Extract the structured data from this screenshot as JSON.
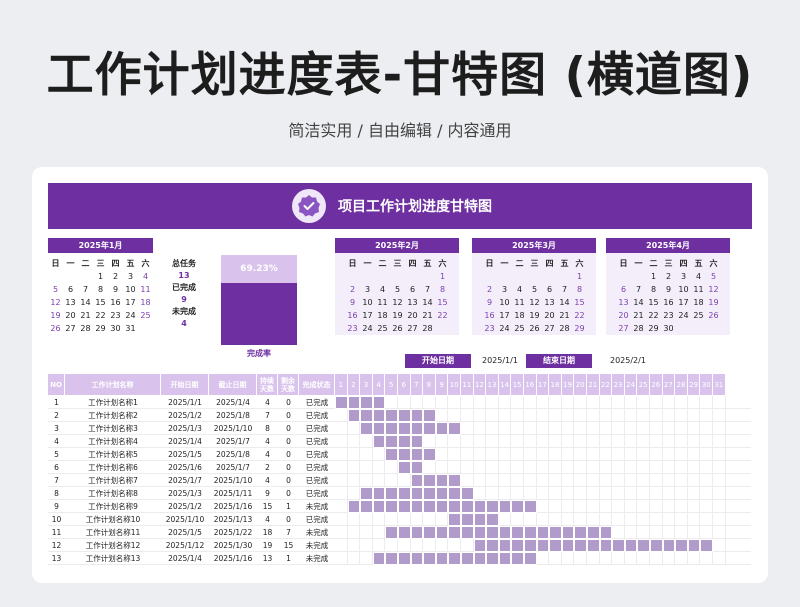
{
  "page": {
    "title": "工作计划进度表-甘特图 (横道图)",
    "subtitle": "简洁实用 / 自由编辑 / 内容通用"
  },
  "banner": {
    "title": "项目工作计划进度甘特图",
    "icon": "check-badge-icon"
  },
  "colors": {
    "accent": "#6e2fa0",
    "light": "#d9c3ed",
    "bar": "#b09bcb",
    "bg": "#eceef1"
  },
  "calendars": [
    {
      "title": "2025年1月",
      "weekdays": [
        "日",
        "一",
        "二",
        "三",
        "四",
        "五",
        "六"
      ],
      "weeks": [
        [
          "",
          "",
          "",
          "1",
          "2",
          "3",
          "4"
        ],
        [
          "5",
          "6",
          "7",
          "8",
          "9",
          "10",
          "11"
        ],
        [
          "12",
          "13",
          "14",
          "15",
          "16",
          "17",
          "18"
        ],
        [
          "19",
          "20",
          "21",
          "22",
          "23",
          "24",
          "25"
        ],
        [
          "26",
          "27",
          "28",
          "29",
          "30",
          "31",
          ""
        ]
      ]
    },
    {
      "title": "2025年2月",
      "weekdays": [
        "日",
        "一",
        "二",
        "三",
        "四",
        "五",
        "六"
      ],
      "weeks": [
        [
          "",
          "",
          "",
          "",
          "",
          "",
          "1"
        ],
        [
          "2",
          "3",
          "4",
          "5",
          "6",
          "7",
          "8"
        ],
        [
          "9",
          "10",
          "11",
          "12",
          "13",
          "14",
          "15"
        ],
        [
          "16",
          "17",
          "18",
          "19",
          "20",
          "21",
          "22"
        ],
        [
          "23",
          "24",
          "25",
          "26",
          "27",
          "28",
          ""
        ]
      ]
    },
    {
      "title": "2025年3月",
      "weekdays": [
        "日",
        "一",
        "二",
        "三",
        "四",
        "五",
        "六"
      ],
      "weeks": [
        [
          "",
          "",
          "",
          "",
          "",
          "",
          "1"
        ],
        [
          "2",
          "3",
          "4",
          "5",
          "6",
          "7",
          "8"
        ],
        [
          "9",
          "10",
          "11",
          "12",
          "13",
          "14",
          "15"
        ],
        [
          "16",
          "17",
          "18",
          "19",
          "20",
          "21",
          "22"
        ],
        [
          "23",
          "24",
          "25",
          "26",
          "27",
          "28",
          "29"
        ]
      ]
    },
    {
      "title": "2025年4月",
      "weekdays": [
        "日",
        "一",
        "二",
        "三",
        "四",
        "五",
        "六"
      ],
      "weeks": [
        [
          "",
          "",
          "1",
          "2",
          "3",
          "4",
          "5"
        ],
        [
          "6",
          "7",
          "8",
          "9",
          "10",
          "11",
          "12"
        ],
        [
          "13",
          "14",
          "15",
          "16",
          "17",
          "18",
          "19"
        ],
        [
          "20",
          "21",
          "22",
          "23",
          "24",
          "25",
          "26"
        ],
        [
          "27",
          "28",
          "29",
          "30",
          "",
          "",
          ""
        ]
      ]
    }
  ],
  "stats": {
    "total_label": "总任务",
    "total_value": "13",
    "done_label": "已完成",
    "done_value": "9",
    "undone_label": "未完成",
    "undone_value": "4"
  },
  "completion": {
    "percent_text": "69.23%",
    "fraction": 0.6923,
    "label": "完成率"
  },
  "dates": {
    "start_label": "开始日期",
    "start_value": "2025/1/1",
    "end_label": "结束日期",
    "end_value": "2025/2/1"
  },
  "table": {
    "headers": {
      "no": "NO",
      "name": "工作计划名称",
      "start": "开始日期",
      "end": "截止日期",
      "duration": "持续天数",
      "remaining": "剩余天数",
      "status": "完成状态"
    },
    "day_headers": [
      "1",
      "2",
      "3",
      "4",
      "5",
      "6",
      "7",
      "8",
      "9",
      "10",
      "11",
      "12",
      "13",
      "14",
      "15",
      "16",
      "17",
      "18",
      "19",
      "20",
      "21",
      "22",
      "23",
      "24",
      "25",
      "26",
      "27",
      "28",
      "29",
      "30",
      "31"
    ],
    "rows": [
      {
        "no": "1",
        "name": "工作计划名称1",
        "start": "2025/1/1",
        "end": "2025/1/4",
        "duration": "4",
        "remaining": "0",
        "status": "已完成",
        "bar_start": 1,
        "bar_len": 4
      },
      {
        "no": "2",
        "name": "工作计划名称2",
        "start": "2025/1/2",
        "end": "2025/1/8",
        "duration": "7",
        "remaining": "0",
        "status": "已完成",
        "bar_start": 2,
        "bar_len": 7
      },
      {
        "no": "3",
        "name": "工作计划名称3",
        "start": "2025/1/3",
        "end": "2025/1/10",
        "duration": "8",
        "remaining": "0",
        "status": "已完成",
        "bar_start": 3,
        "bar_len": 8
      },
      {
        "no": "4",
        "name": "工作计划名称4",
        "start": "2025/1/4",
        "end": "2025/1/7",
        "duration": "4",
        "remaining": "0",
        "status": "已完成",
        "bar_start": 4,
        "bar_len": 4
      },
      {
        "no": "5",
        "name": "工作计划名称5",
        "start": "2025/1/5",
        "end": "2025/1/8",
        "duration": "4",
        "remaining": "0",
        "status": "已完成",
        "bar_start": 5,
        "bar_len": 4
      },
      {
        "no": "6",
        "name": "工作计划名称6",
        "start": "2025/1/6",
        "end": "2025/1/7",
        "duration": "2",
        "remaining": "0",
        "status": "已完成",
        "bar_start": 6,
        "bar_len": 2
      },
      {
        "no": "7",
        "name": "工作计划名称7",
        "start": "2025/1/7",
        "end": "2025/1/10",
        "duration": "4",
        "remaining": "0",
        "status": "已完成",
        "bar_start": 7,
        "bar_len": 4
      },
      {
        "no": "8",
        "name": "工作计划名称8",
        "start": "2025/1/3",
        "end": "2025/1/11",
        "duration": "9",
        "remaining": "0",
        "status": "已完成",
        "bar_start": 3,
        "bar_len": 9
      },
      {
        "no": "9",
        "name": "工作计划名称9",
        "start": "2025/1/2",
        "end": "2025/1/16",
        "duration": "15",
        "remaining": "1",
        "status": "未完成",
        "bar_start": 2,
        "bar_len": 15
      },
      {
        "no": "10",
        "name": "工作计划名称10",
        "start": "2025/1/10",
        "end": "2025/1/13",
        "duration": "4",
        "remaining": "0",
        "status": "已完成",
        "bar_start": 10,
        "bar_len": 4
      },
      {
        "no": "11",
        "name": "工作计划名称11",
        "start": "2025/1/5",
        "end": "2025/1/22",
        "duration": "18",
        "remaining": "7",
        "status": "未完成",
        "bar_start": 5,
        "bar_len": 18
      },
      {
        "no": "12",
        "name": "工作计划名称12",
        "start": "2025/1/12",
        "end": "2025/1/30",
        "duration": "19",
        "remaining": "15",
        "status": "未完成",
        "bar_start": 12,
        "bar_len": 19
      },
      {
        "no": "13",
        "name": "工作计划名称13",
        "start": "2025/1/4",
        "end": "2025/1/16",
        "duration": "13",
        "remaining": "1",
        "status": "未完成",
        "bar_start": 4,
        "bar_len": 13
      }
    ]
  }
}
